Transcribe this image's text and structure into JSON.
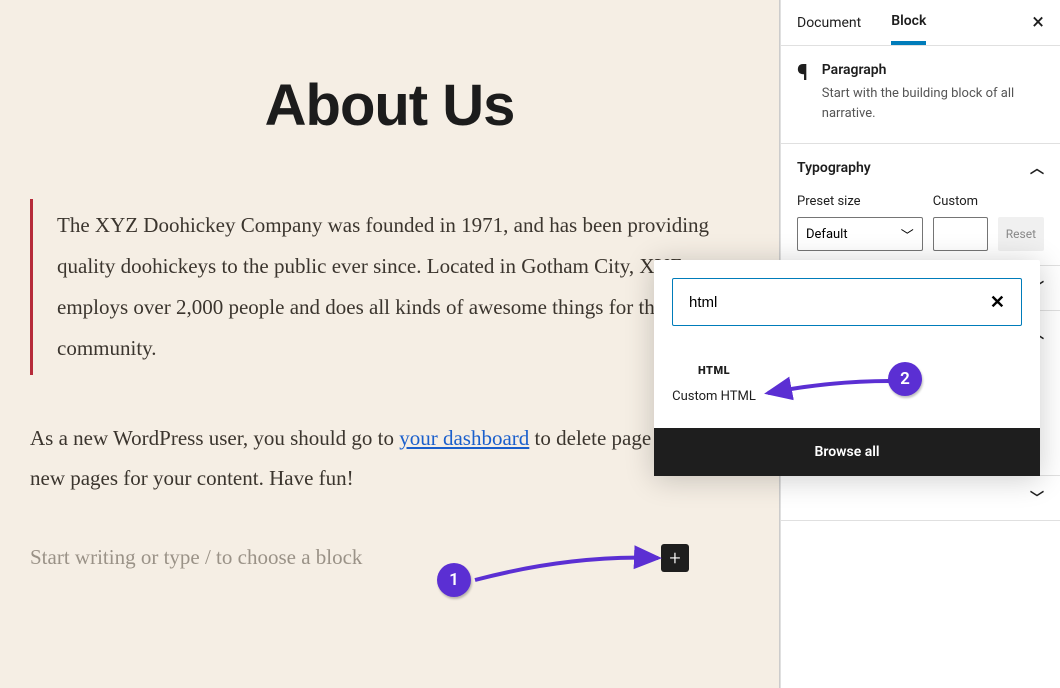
{
  "editor": {
    "page_title": "About Us",
    "blockquote": "The XYZ Doohickey Company was founded in 1971, and has been providing quality doohickeys to the public ever since. Located in Gotham City, XYZ employs over 2,000 people and does all kinds of awesome things for the Gotham community.",
    "paragraph_before_link": "As a new WordPress user, you should go to ",
    "dashboard_link": "your dashboard",
    "paragraph_after_link": " to delete page and create new pages for your content. Have fun!",
    "placeholder": "Start writing or type / to choose a block"
  },
  "inserter": {
    "search_value": "html",
    "result_icon_label": "HTML",
    "result_label": "Custom HTML",
    "browse_all": "Browse all"
  },
  "sidebar": {
    "tabs": {
      "document": "Document",
      "block": "Block"
    },
    "block": {
      "name": "Paragraph",
      "description": "Start with the building block of all narrative."
    },
    "typography": {
      "title": "Typography",
      "preset_label": "Preset size",
      "custom_label": "Custom",
      "preset_value": "Default",
      "reset": "Reset"
    }
  },
  "annotations": {
    "badge1": "1",
    "badge2": "2"
  }
}
